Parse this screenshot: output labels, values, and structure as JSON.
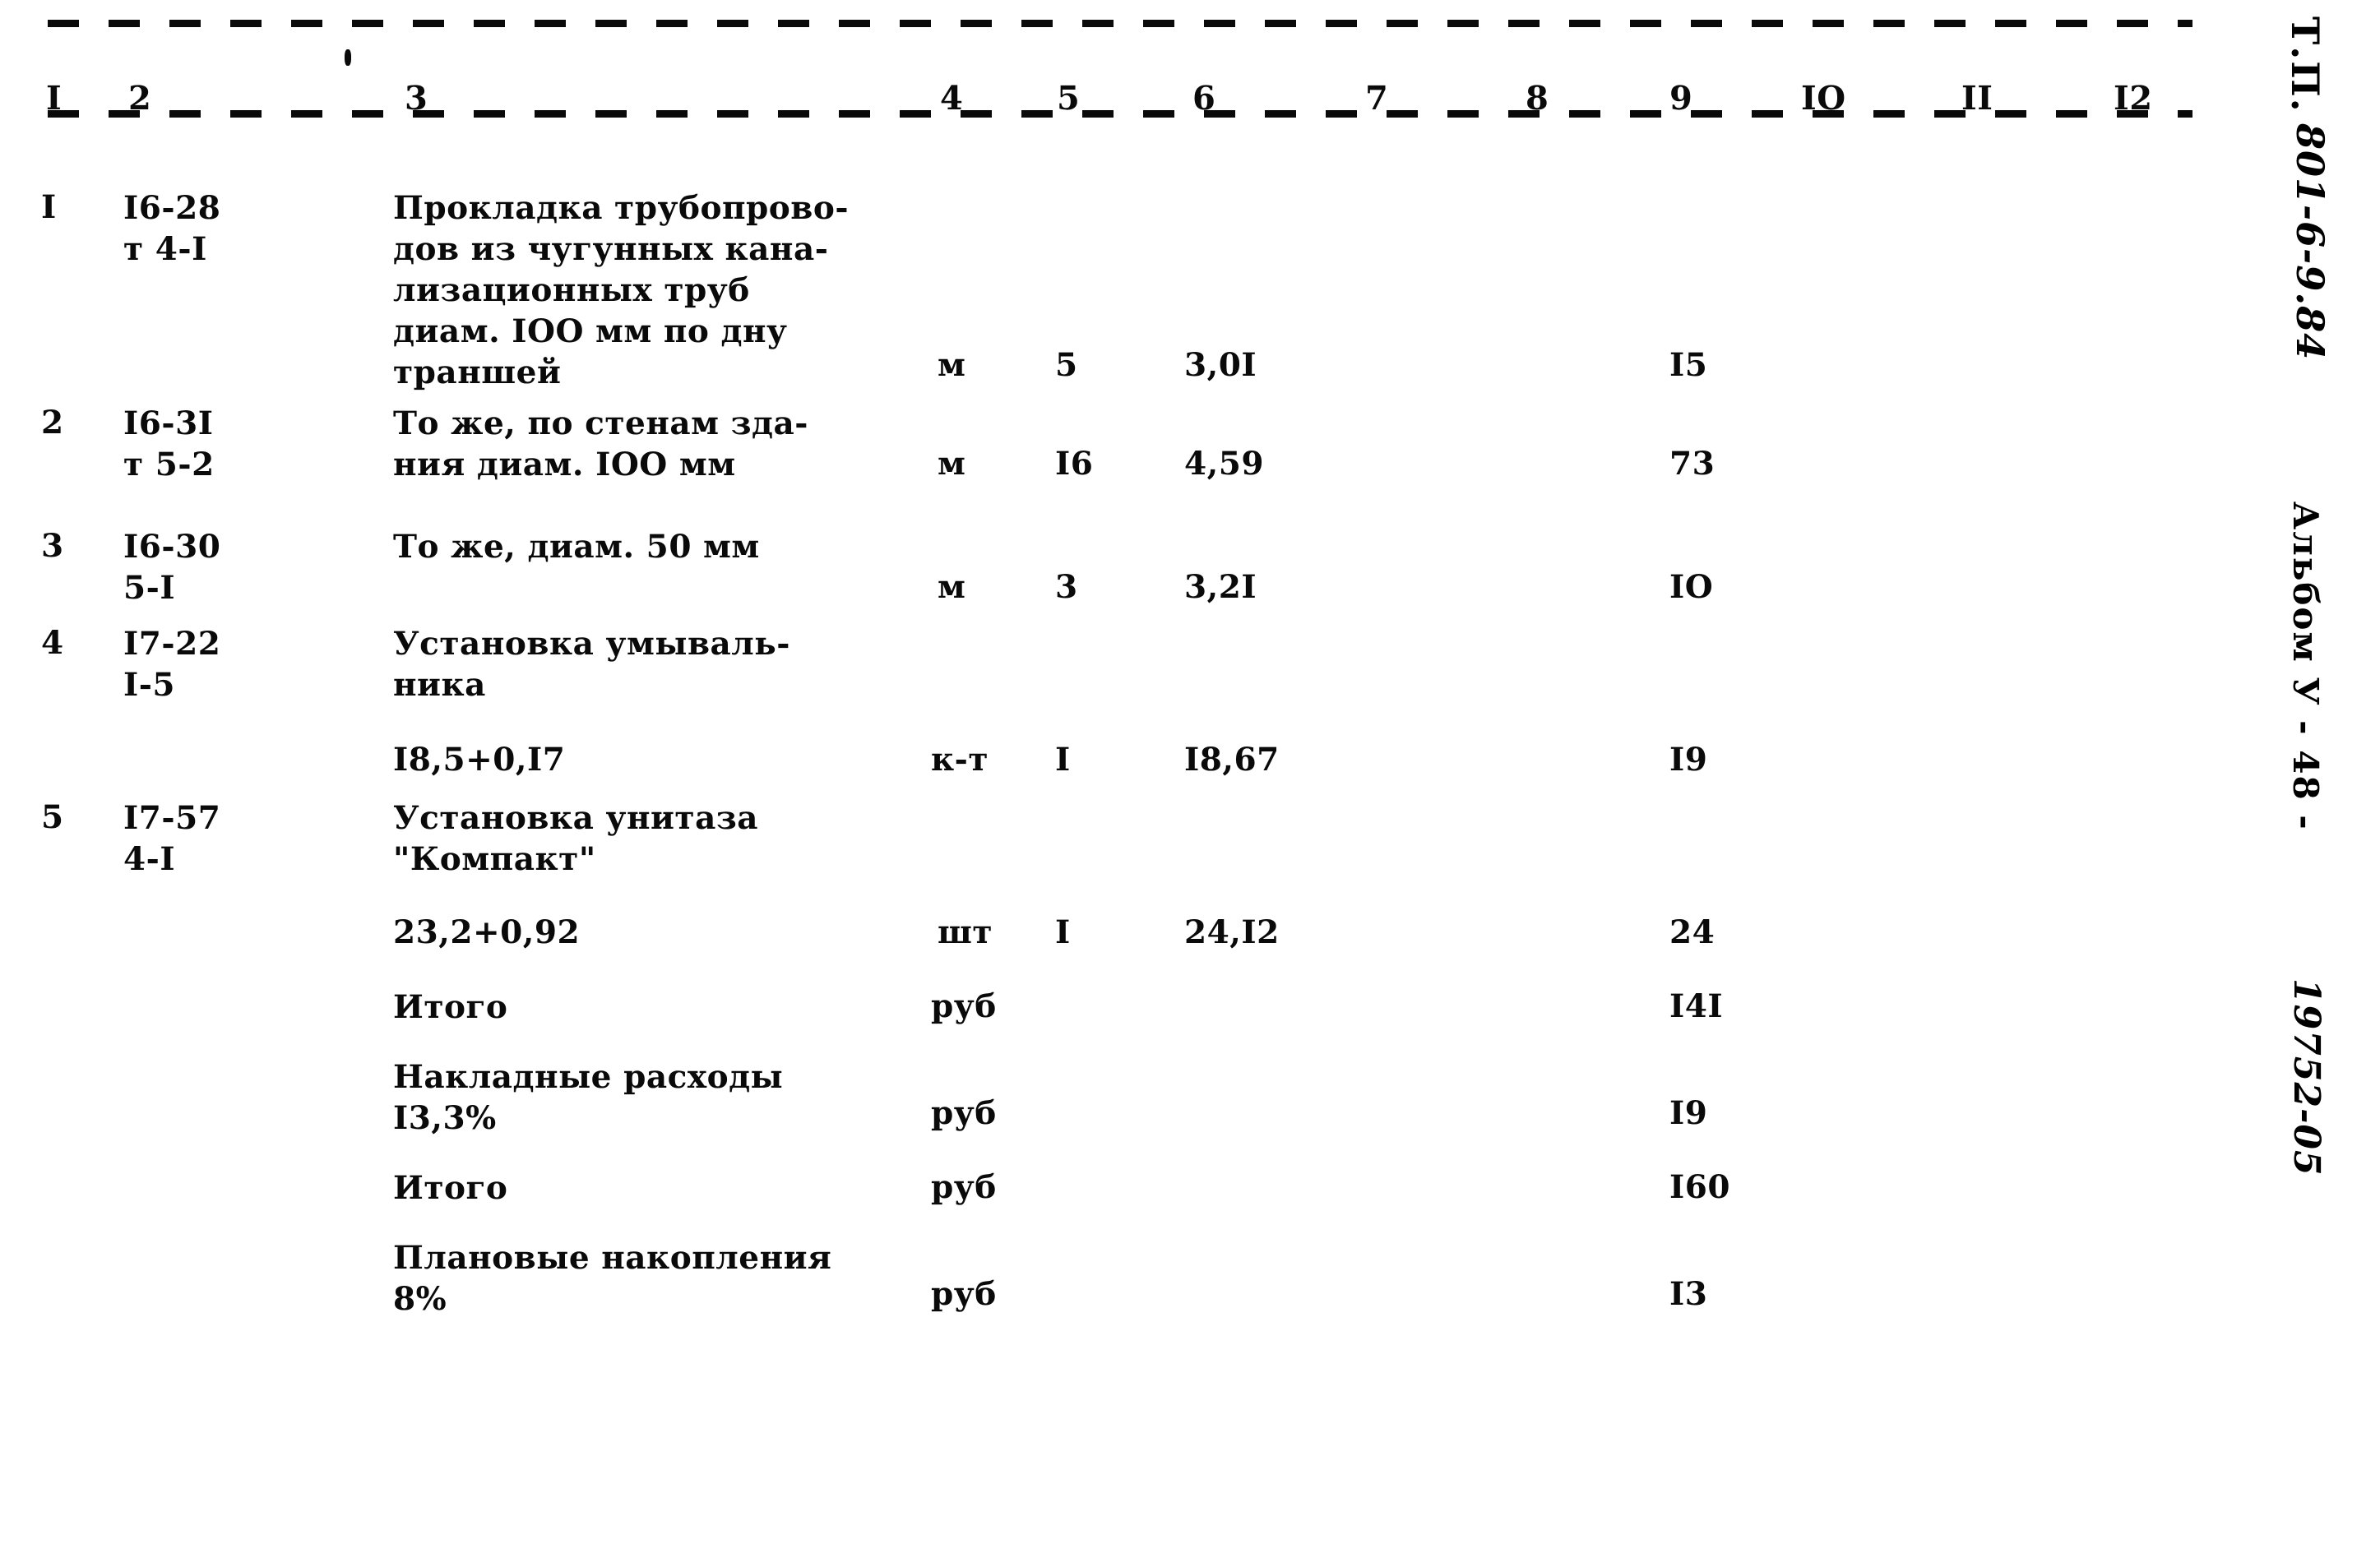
{
  "document": {
    "kind": "Локальная смета (фрагмент таблицы)",
    "column_headers": [
      "I",
      "2",
      "3",
      "4",
      "5",
      "6",
      "7",
      "8",
      "9",
      "IO",
      "II",
      "I2"
    ]
  },
  "margin": {
    "type_label": "Т.П.",
    "type_code": "801-6-9.84",
    "album_label": "Альбом У  -  48  -",
    "doc_number": "19752-05"
  },
  "rows": [
    {
      "no": "I",
      "code": "I6-28\nт 4-I",
      "description": "Прокладка трубопрово-\nдов из чугунных кана-\nлизационных труб\nдиам. IOO мм по дну\nтраншей",
      "unit": "м",
      "qty": "5",
      "price": "3,0I",
      "col7": "",
      "col8": "",
      "total": "I5",
      "col10": "",
      "col11": "",
      "col12": ""
    },
    {
      "no": "2",
      "code": "I6-3I\nт 5-2",
      "description": "То же, по стенам зда-\nния диам. IOO мм",
      "unit": "м",
      "qty": "I6",
      "price": "4,59",
      "col7": "",
      "col8": "",
      "total": "73",
      "col10": "",
      "col11": "",
      "col12": ""
    },
    {
      "no": "3",
      "code": "I6-30\n5-I",
      "description": "То же, диам. 50 мм",
      "unit": "м",
      "qty": "3",
      "price": "3,2I",
      "col7": "",
      "col8": "",
      "total": "IO",
      "col10": "",
      "col11": "",
      "col12": ""
    },
    {
      "no": "4",
      "code": "I7-22\nI-5",
      "description": "Установка умываль-\nника",
      "formula": "I8,5+0,I7",
      "unit": "к-т",
      "qty": "I",
      "price": "I8,67",
      "col7": "",
      "col8": "",
      "total": "I9",
      "col10": "",
      "col11": "",
      "col12": ""
    },
    {
      "no": "5",
      "code": "I7-57\n4-I",
      "description": "Установка унитаза\n\"Компакт\"",
      "formula": "23,2+0,92",
      "unit": "шт",
      "qty": "I",
      "price": "24,I2",
      "col7": "",
      "col8": "",
      "total": "24",
      "col10": "",
      "col11": "",
      "col12": ""
    }
  ],
  "summary": [
    {
      "label": "Итого",
      "unit": "руб",
      "total": "I4I"
    },
    {
      "label": "Накладные расходы\nI3,3%",
      "unit": "руб",
      "total": "I9"
    },
    {
      "label": "Итого",
      "unit": "руб",
      "total": "I60"
    },
    {
      "label": "Плановые накопления\n8%",
      "unit": "руб",
      "total": "I3"
    }
  ]
}
